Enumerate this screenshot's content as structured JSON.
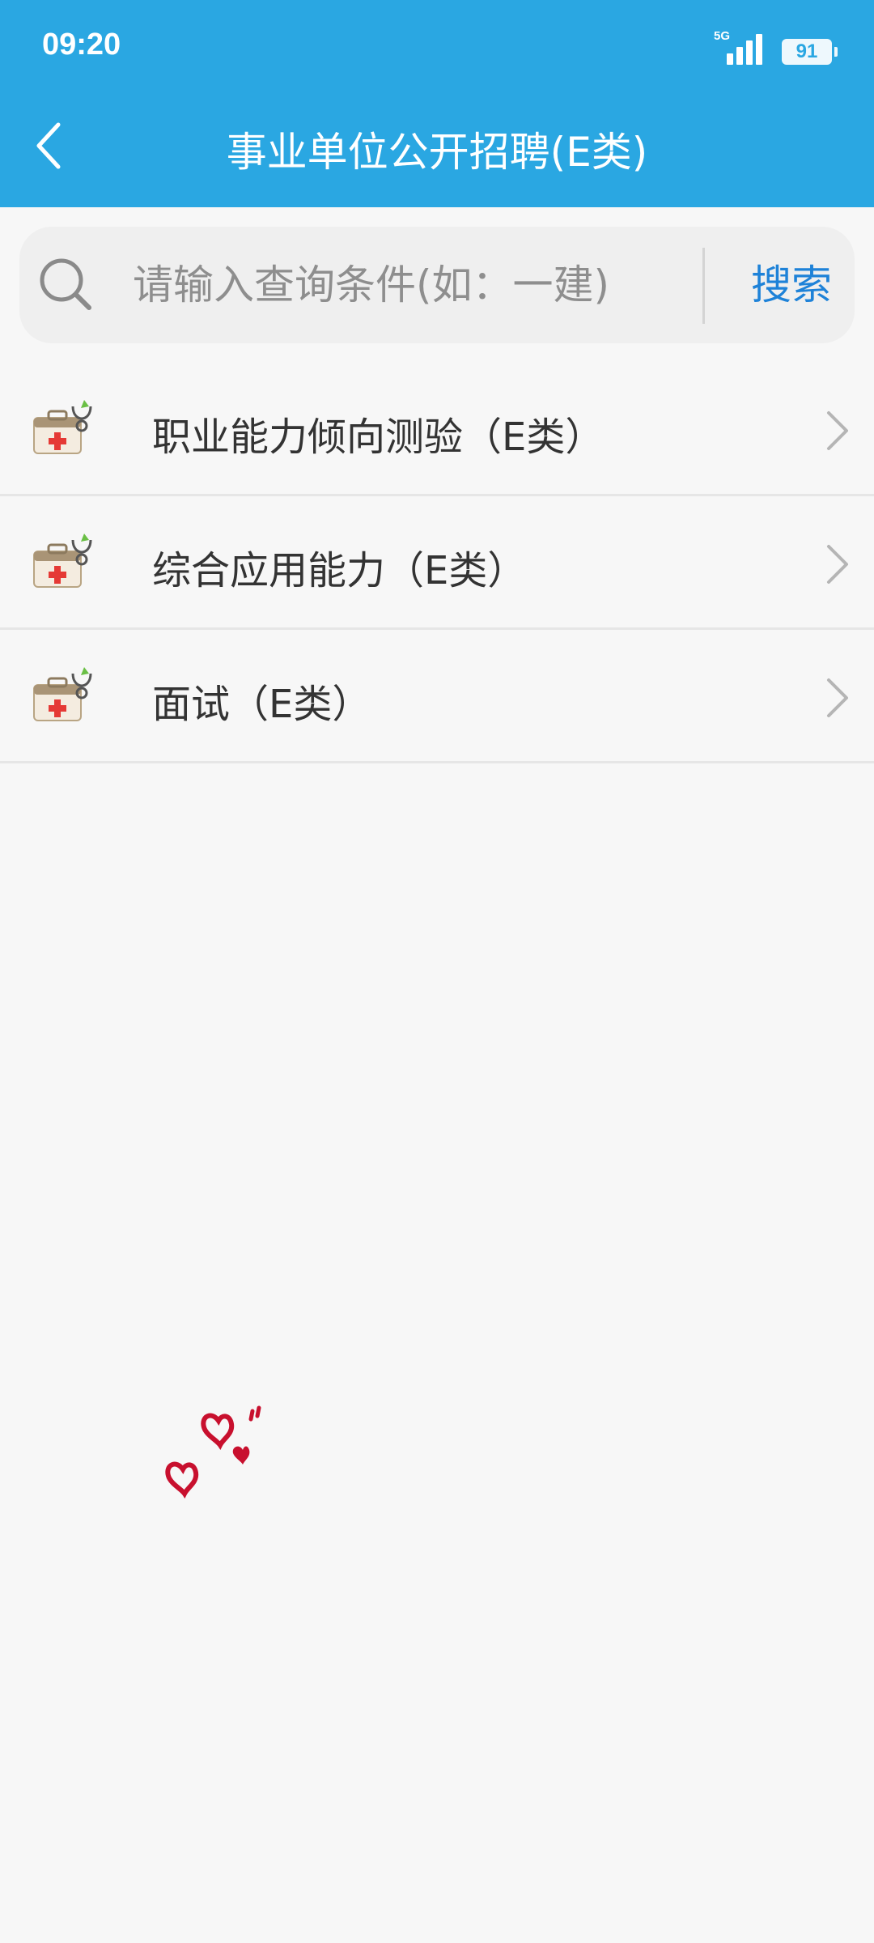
{
  "status_bar": {
    "time": "09:20",
    "network": "5G",
    "battery_level": "91"
  },
  "header": {
    "title": "事业单位公开招聘(E类)"
  },
  "search": {
    "placeholder": "请输入查询条件(如：一建)",
    "value": "",
    "button_label": "搜索"
  },
  "list": {
    "items": [
      {
        "label": "职业能力倾向测验（E类）",
        "icon": "medical-kit-icon"
      },
      {
        "label": "综合应用能力（E类）",
        "icon": "medical-kit-icon"
      },
      {
        "label": "面试（E类）",
        "icon": "medical-kit-icon"
      }
    ]
  },
  "colors": {
    "header_background": "#2aa7e2",
    "search_button": "#1e82d8",
    "page_background": "#f7f7f7",
    "hearts": "#c8102e"
  }
}
